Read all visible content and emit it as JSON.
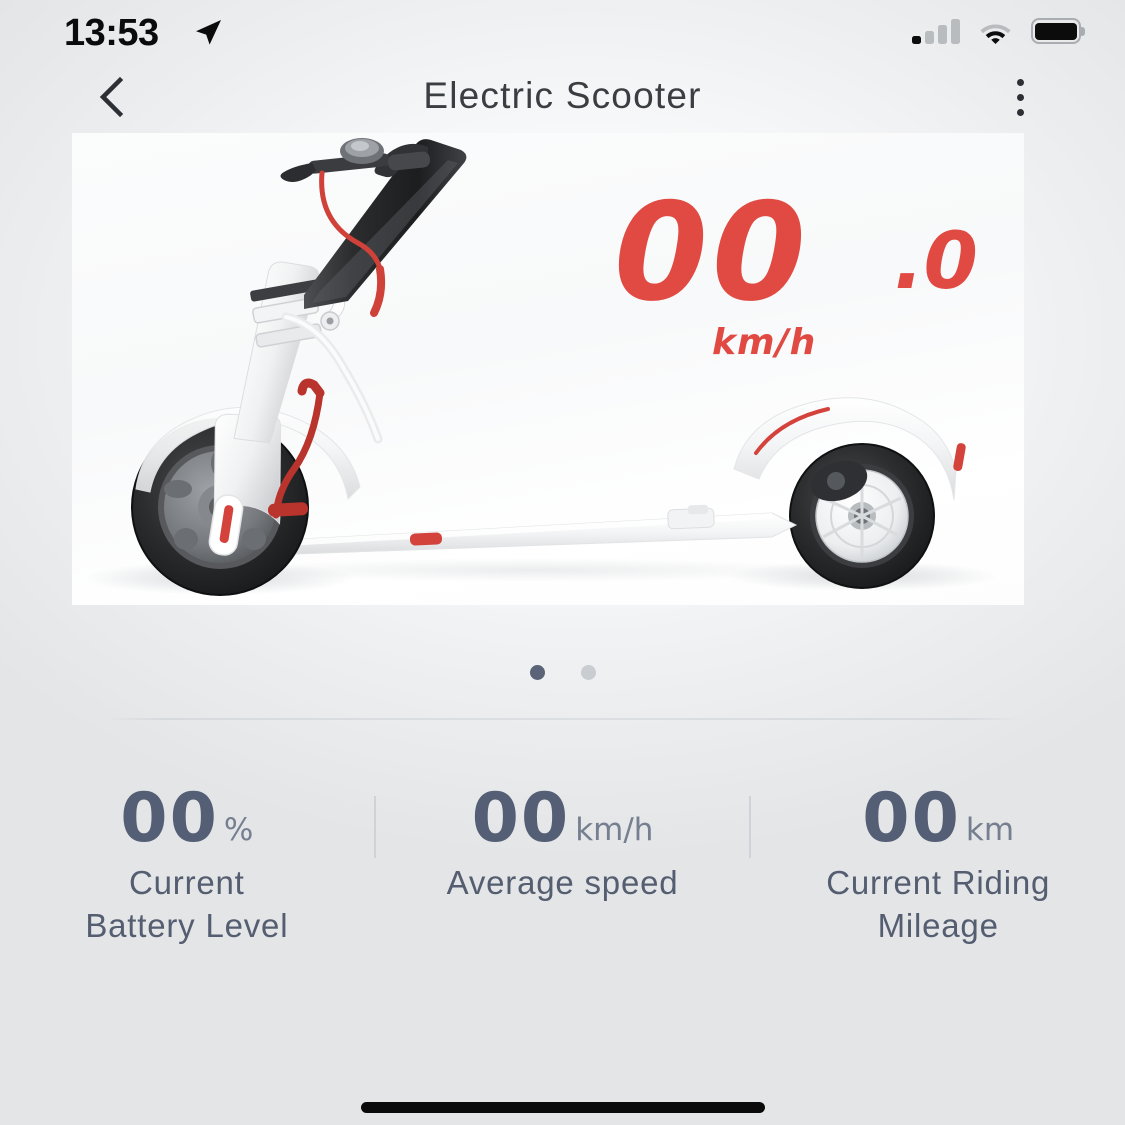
{
  "status_bar": {
    "time": "13:53",
    "location_icon": "location-arrow-icon",
    "signal_icon": "cellular-signal-icon",
    "signal_bars_filled": 1,
    "signal_bars_total": 4,
    "wifi_icon": "wifi-icon",
    "battery_icon": "battery-full-icon",
    "battery_level_pct": 100
  },
  "nav": {
    "back_icon": "chevron-left-icon",
    "title": "Electric Scooter",
    "menu_icon": "more-vertical-icon"
  },
  "hero": {
    "alt": "electric-scooter-side-view",
    "pages": [
      {
        "label": "1",
        "active": true
      },
      {
        "label": "2",
        "active": false
      }
    ]
  },
  "speed": {
    "value": "00",
    "decimal": ".0",
    "unit": "km/h",
    "color": "#e04a42"
  },
  "stats": [
    {
      "value": "00",
      "unit": "%",
      "label": "Current\nBattery Level",
      "label_line1": "Current",
      "label_line2": "Battery Level"
    },
    {
      "value": "00",
      "unit": "km/h",
      "label": "Average speed",
      "label_line1": "Average speed",
      "label_line2": ""
    },
    {
      "value": "00",
      "unit": "km",
      "label": "Current Riding\nMileage",
      "label_line1": "Current Riding",
      "label_line2": "Mileage"
    }
  ],
  "colors": {
    "accent_red": "#e04a42",
    "stat_text": "#545e74",
    "stat_unit": "#767f90",
    "nav_title": "#3a3d41",
    "background": "#e4e6e8",
    "dot_active": "#5a6378",
    "dot_inactive": "#c9ccd1"
  },
  "home_indicator": {
    "name": "home-indicator"
  }
}
